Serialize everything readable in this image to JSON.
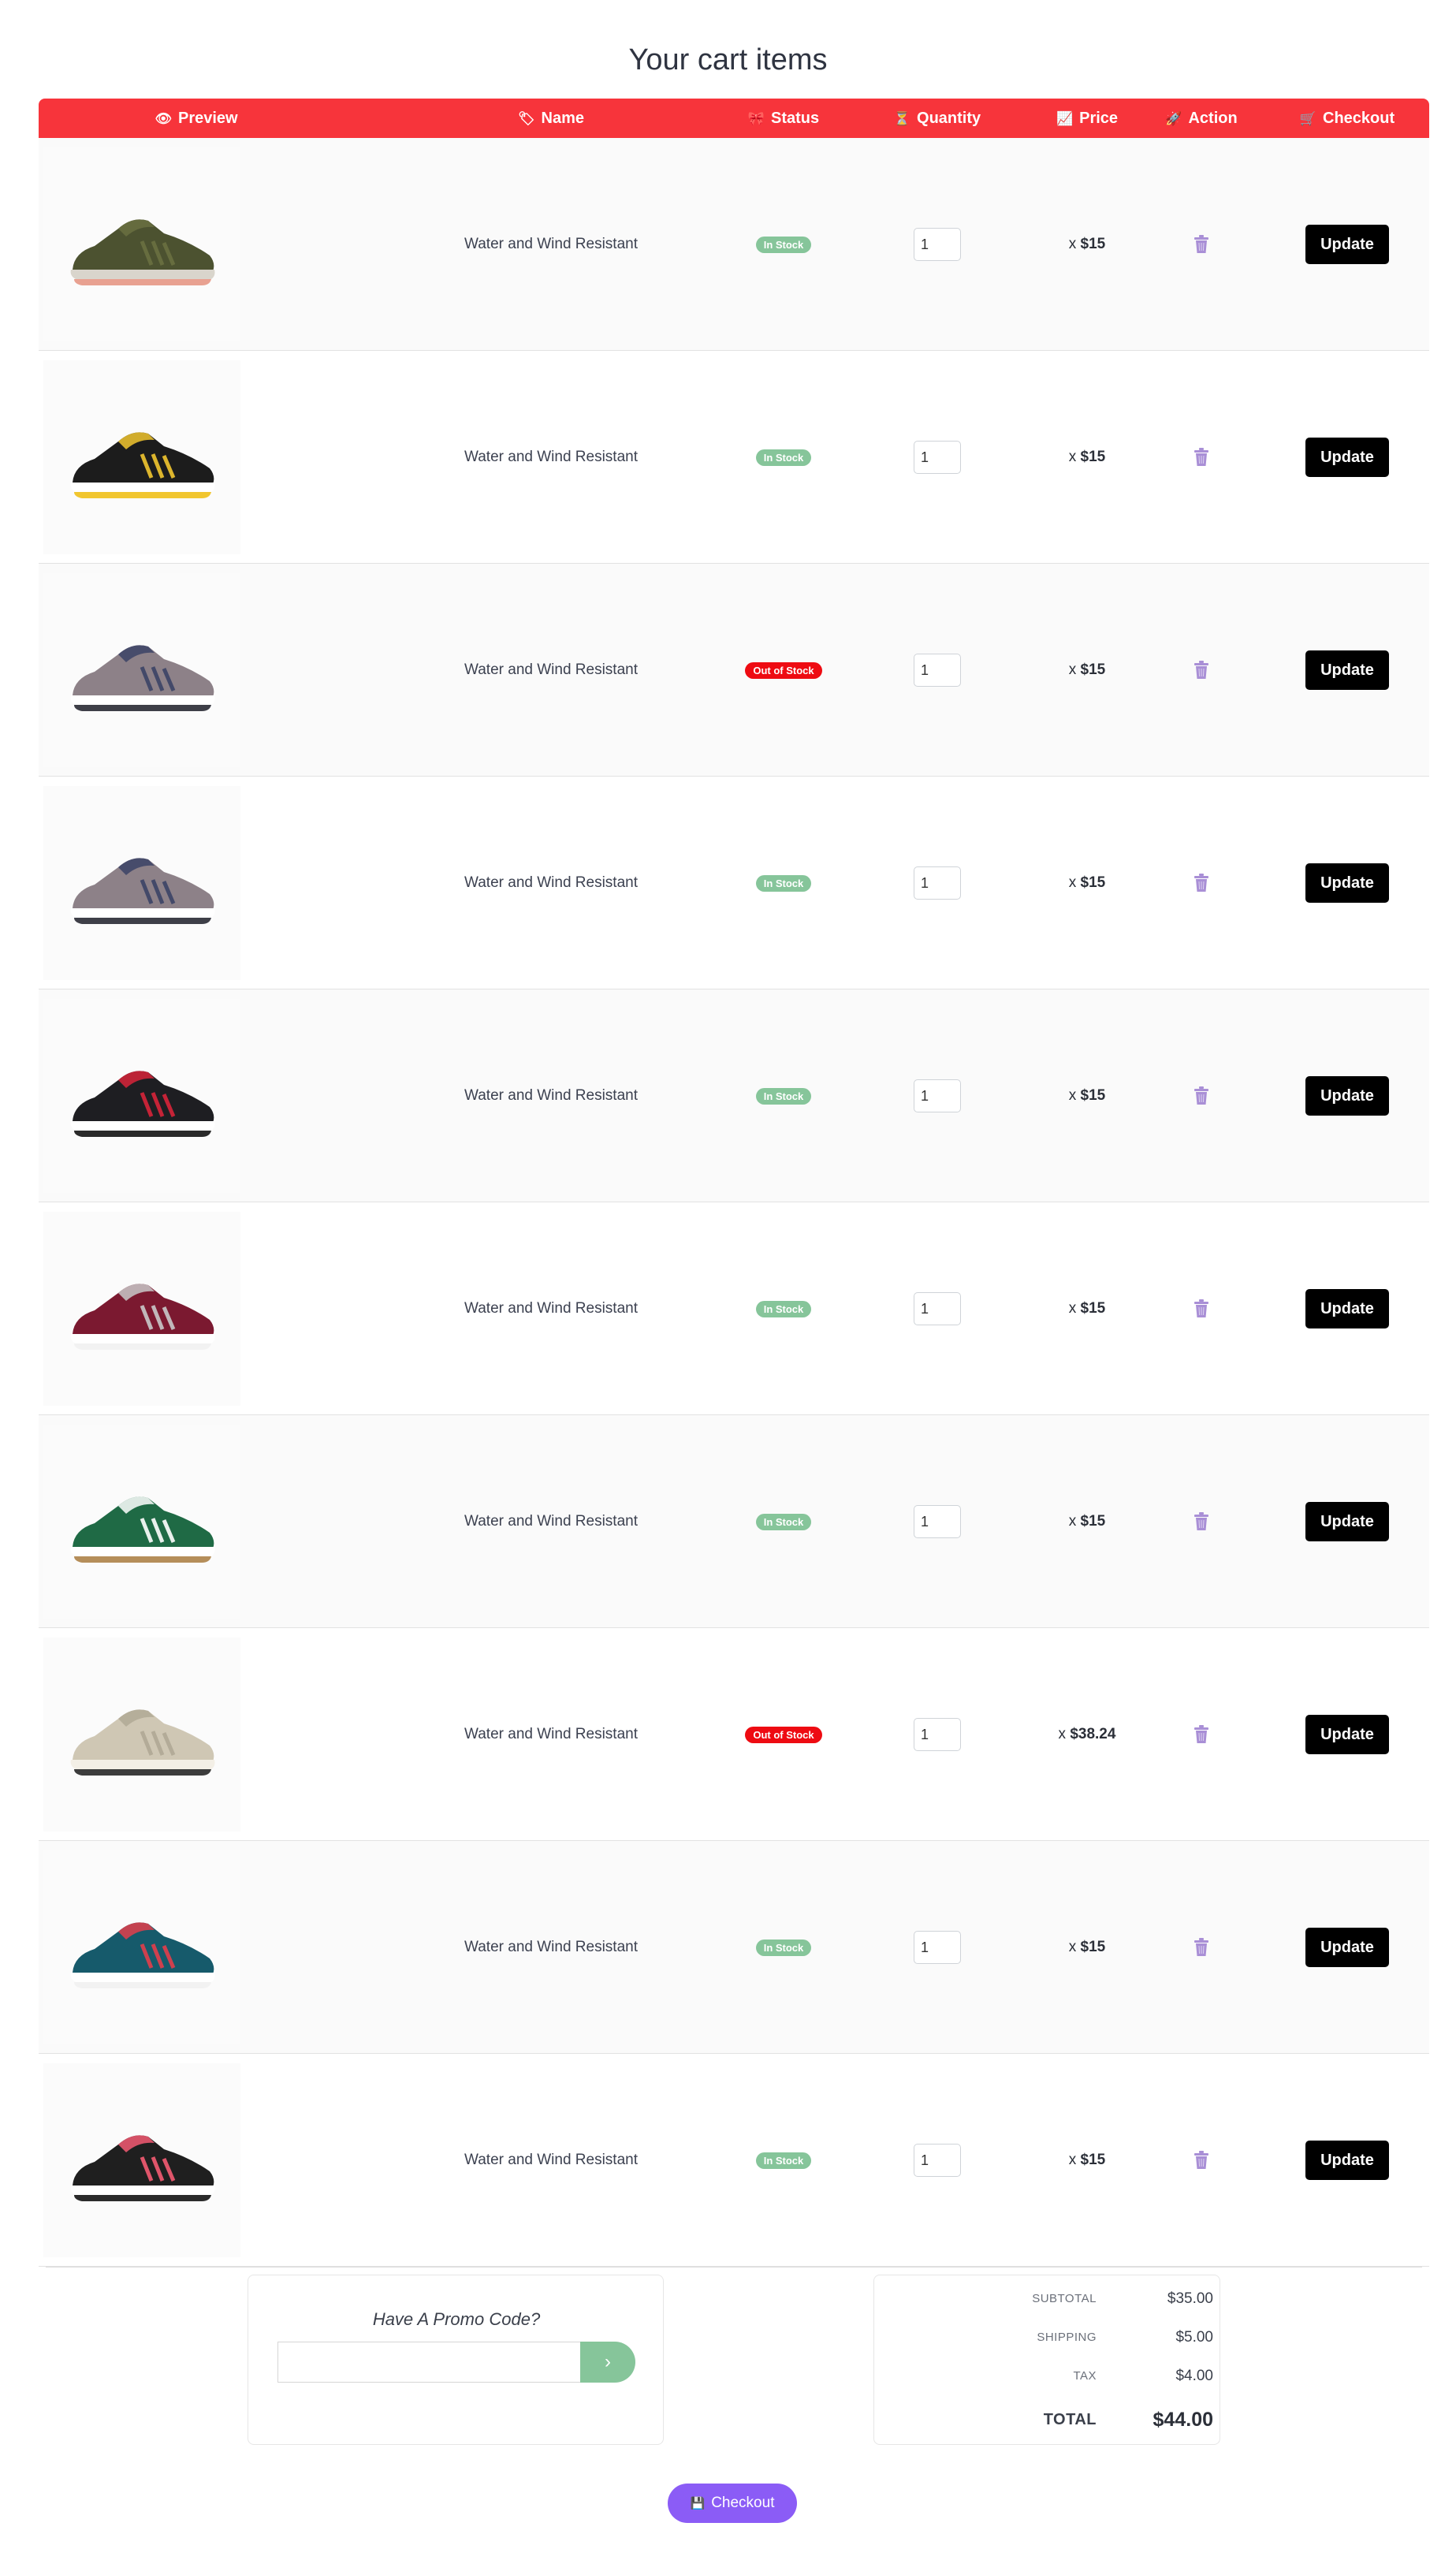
{
  "page": {
    "title": "Your cart items"
  },
  "table": {
    "headers": [
      {
        "icon": "eye-icon",
        "glyph": "👁",
        "label": "Preview"
      },
      {
        "icon": "tag-icon",
        "glyph": "🏷",
        "label": "Name"
      },
      {
        "icon": "status-icon",
        "glyph": "🎀",
        "label": "Status"
      },
      {
        "icon": "hourglass-icon",
        "glyph": "⏳",
        "label": "Quantity"
      },
      {
        "icon": "chart-icon",
        "glyph": "📈",
        "label": "Price"
      },
      {
        "icon": "rocket-icon",
        "glyph": "🚀",
        "label": "Action"
      },
      {
        "icon": "cart-icon",
        "glyph": "🛒",
        "label": "Checkout"
      }
    ],
    "rows": [
      {
        "shoe": "olive-green-sneaker",
        "name": "Water and Wind Resistant",
        "status": "In Stock",
        "in_stock": true,
        "qty": "1",
        "price_prefix": "x",
        "price": "$15",
        "update_label": "Update"
      },
      {
        "shoe": "black-yellow-sneaker",
        "name": "Water and Wind Resistant",
        "status": "In Stock",
        "in_stock": true,
        "qty": "1",
        "price_prefix": "x",
        "price": "$15",
        "update_label": "Update"
      },
      {
        "shoe": "grey-white-runner",
        "name": "Water and Wind Resistant",
        "status": "Out of Stock",
        "in_stock": false,
        "qty": "1",
        "price_prefix": "x",
        "price": "$15",
        "update_label": "Update"
      },
      {
        "shoe": "grey-white-runner",
        "name": "Water and Wind Resistant",
        "status": "In Stock",
        "in_stock": true,
        "qty": "1",
        "price_prefix": "x",
        "price": "$15",
        "update_label": "Update"
      },
      {
        "shoe": "black-striped-runner",
        "name": "Water and Wind Resistant",
        "status": "In Stock",
        "in_stock": true,
        "qty": "1",
        "price_prefix": "x",
        "price": "$15",
        "update_label": "Update"
      },
      {
        "shoe": "burgundy-sneaker",
        "name": "Water and Wind Resistant",
        "status": "In Stock",
        "in_stock": true,
        "qty": "1",
        "price_prefix": "x",
        "price": "$15",
        "update_label": "Update"
      },
      {
        "shoe": "green-court-sneaker",
        "name": "Water and Wind Resistant",
        "status": "In Stock",
        "in_stock": true,
        "qty": "1",
        "price_prefix": "x",
        "price": "$15",
        "update_label": "Update"
      },
      {
        "shoe": "beige-knit-sneaker",
        "name": "Water and Wind Resistant",
        "status": "Out of Stock",
        "in_stock": false,
        "qty": "1",
        "price_prefix": "x",
        "price": "$38.24",
        "update_label": "Update"
      },
      {
        "shoe": "teal-knit-sneaker",
        "name": "Water and Wind Resistant",
        "status": "In Stock",
        "in_stock": true,
        "qty": "1",
        "price_prefix": "x",
        "price": "$15",
        "update_label": "Update"
      },
      {
        "shoe": "black-pink-sneaker",
        "name": "Water and Wind Resistant",
        "status": "In Stock",
        "in_stock": true,
        "qty": "1",
        "price_prefix": "x",
        "price": "$15",
        "update_label": "Update"
      }
    ]
  },
  "promo": {
    "title": "Have A Promo Code?",
    "placeholder": "",
    "submit_icon": "chevron-right-icon",
    "submit_glyph": "›"
  },
  "totals": {
    "subtotal_label": "SUBTOTAL",
    "subtotal": "$35.00",
    "shipping_label": "SHIPPING",
    "shipping": "$5.00",
    "tax_label": "TAX",
    "tax": "$4.00",
    "total_label": "TOTAL",
    "total": "$44.00"
  },
  "checkout": {
    "icon": "floppy-icon",
    "glyph": "💾",
    "label": "Checkout"
  },
  "colors": {
    "header": "#f7343b",
    "in_stock": "#86c59a",
    "out_of_stock": "#ee0b12",
    "checkout": "#8b5cf6",
    "trash": "#a98fd6"
  }
}
